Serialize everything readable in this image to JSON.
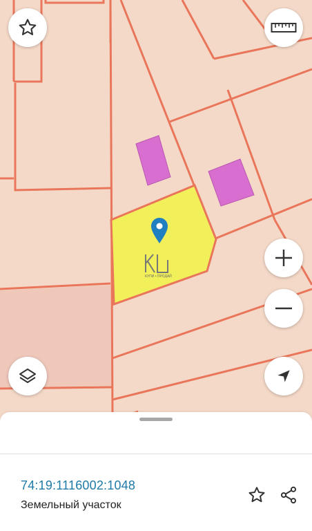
{
  "map": {
    "colors": {
      "background": "#f5d9c8",
      "boundary": "#e9765a",
      "selected_parcel": "#f2f05a",
      "building": "#d86ed0",
      "shaded_parcel": "#efc8ba",
      "pin": "#1f7fc0"
    },
    "watermark_caption": "КУПИ • ПРОДАЙ"
  },
  "controls": {
    "favorite_icon": "star-outline-icon",
    "ruler_icon": "ruler-icon",
    "zoom_in_icon": "plus-icon",
    "zoom_out_icon": "minus-icon",
    "layers_icon": "layers-icon",
    "locate_icon": "navigation-arrow-icon"
  },
  "sheet": {
    "cadastral_number": "74:19:1116002:1048",
    "object_type": "Земельный участок",
    "favorite_icon": "star-outline-icon",
    "share_icon": "share-icon"
  }
}
